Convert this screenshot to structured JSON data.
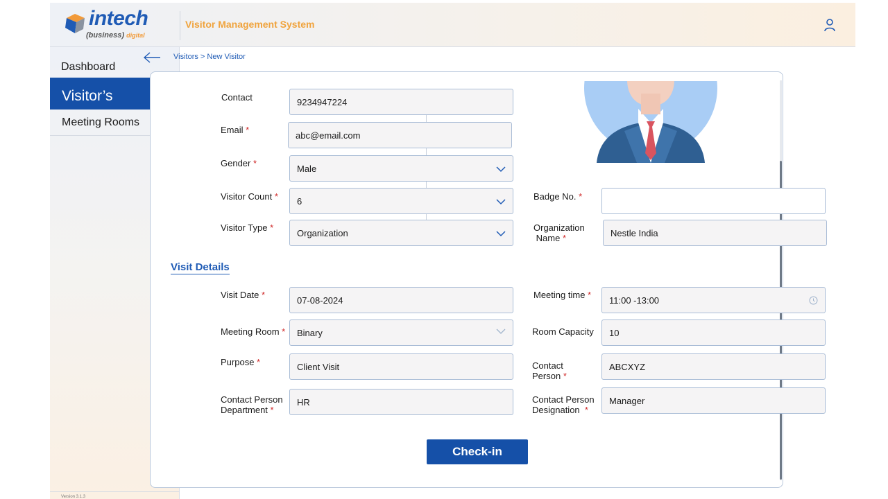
{
  "brand": {
    "logo_word": "intech",
    "logo_sub": "(business)",
    "logo_sub_accent": "digital",
    "title": "Visitor Management System"
  },
  "sidebar": {
    "items": [
      {
        "label": "Dashboard"
      },
      {
        "label": "Visitor’s",
        "active": true
      },
      {
        "label": "Meeting Rooms"
      }
    ],
    "version": "Version 3.1.3"
  },
  "breadcrumb": "Visitors > New Visitor",
  "form": {
    "contact": {
      "label": "Contact",
      "value": "9234947224"
    },
    "email": {
      "label": "Email",
      "value": "abc@email.com"
    },
    "gender": {
      "label": "Gender",
      "value": "Male"
    },
    "visitor_count": {
      "label": "Visitor Count",
      "value": "6"
    },
    "visitor_type": {
      "label": "Visitor Type",
      "value": "Organization"
    },
    "badge_no": {
      "label": "Badge No.",
      "value": ""
    },
    "org_name": {
      "label_line1": "Organization",
      "label_line2": "Name",
      "value": "Nestle India"
    },
    "section_title": "Visit Details",
    "visit_date": {
      "label": "Visit Date",
      "value": "07-08-2024"
    },
    "meeting_time": {
      "label": "Meeting time",
      "value": "11:00 -13:00"
    },
    "meeting_room": {
      "label": "Meeting Room",
      "value": "Binary"
    },
    "room_capacity": {
      "label": "Room Capacity",
      "value": "10"
    },
    "purpose": {
      "label": "Purpose",
      "value": "Client Visit"
    },
    "contact_person": {
      "label_line1": "Contact",
      "label_line2": "Person",
      "value": "ABCXYZ"
    },
    "cp_department": {
      "label_line1": "Contact Person",
      "label_line2": "Department",
      "value": "HR"
    },
    "cp_designation": {
      "label_line1": "Contact Person",
      "label_line2": "Designation",
      "value": "Manager"
    },
    "submit_label": "Check-in",
    "required_mark": "*"
  },
  "colors": {
    "primary": "#1550a8",
    "accent": "#f0a33c",
    "required": "#d02a2a"
  }
}
